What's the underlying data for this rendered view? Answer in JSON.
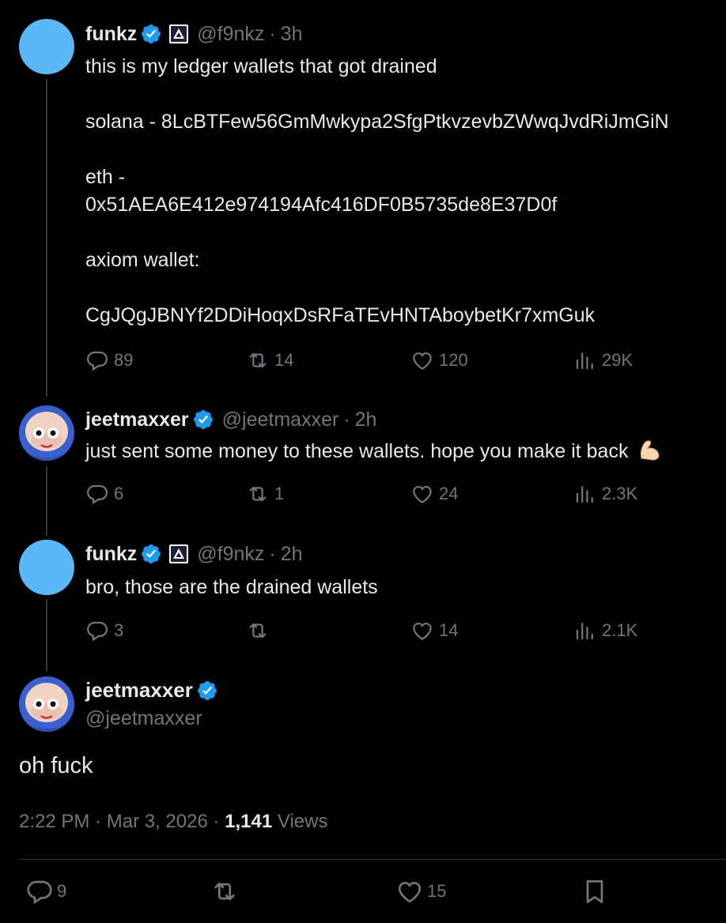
{
  "tweets": [
    {
      "name": "funkz",
      "handle": "@f9nkz",
      "time": "3h",
      "text": "this is my ledger wallets that got drained\n\nsolana - 8LcBTFew56GmMwkypa2SfgPtkvzevbZWwqJvdRiJmGiN\n\neth -\n0x51AEA6E412e974194Afc416DF0B5735de8E37D0f\n\naxiom wallet:\n\nCgJQgJBNYf2DDiHoqxDsRFaTEvHNTAboybetKr7xmGuk",
      "replies": "89",
      "reposts": "14",
      "likes": "120",
      "views": "29K"
    },
    {
      "name": "jeetmaxxer",
      "handle": "@jeetmaxxer",
      "time": "2h",
      "text": "just sent some money to these wallets. hope you make it back",
      "emoji": "flexed-biceps",
      "replies": "6",
      "reposts": "1",
      "likes": "24",
      "views": "2.3K"
    },
    {
      "name": "funkz",
      "handle": "@f9nkz",
      "time": "2h",
      "text": "bro, those are the drained wallets",
      "replies": "3",
      "reposts": "",
      "likes": "14",
      "views": "2.1K"
    }
  ],
  "main": {
    "name": "jeetmaxxer",
    "handle": "@jeetmaxxer",
    "text": "oh fuck",
    "time": "2:22 PM",
    "date": "Mar 3, 2026",
    "views_count": "1,141",
    "views_label": "Views",
    "replies": "9",
    "likes": "15"
  },
  "separator": "·",
  "colors": {
    "background": "#000000",
    "text": "#e7e9ea",
    "muted": "#71767b",
    "verified": "#1d9bf0",
    "avatar": "#5bb8f6"
  }
}
